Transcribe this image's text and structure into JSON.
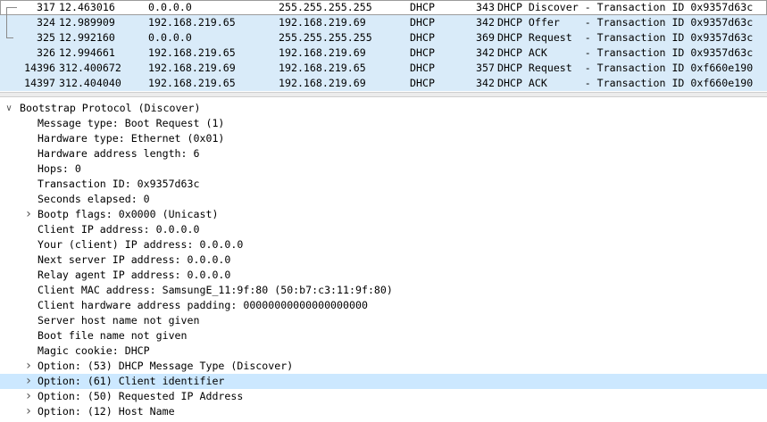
{
  "packet_list": {
    "rows": [
      {
        "no": "317",
        "time": "12.463016",
        "src": "0.0.0.0",
        "dst": "255.255.255.255",
        "proto": "DHCP",
        "len": "343",
        "info": "DHCP Discover - Transaction ID 0x9357d63c",
        "selected": true
      },
      {
        "no": "324",
        "time": "12.989909",
        "src": "192.168.219.65",
        "dst": "192.168.219.69",
        "proto": "DHCP",
        "len": "342",
        "info": "DHCP Offer    - Transaction ID 0x9357d63c",
        "selected": false
      },
      {
        "no": "325",
        "time": "12.992160",
        "src": "0.0.0.0",
        "dst": "255.255.255.255",
        "proto": "DHCP",
        "len": "369",
        "info": "DHCP Request  - Transaction ID 0x9357d63c",
        "selected": false
      },
      {
        "no": "326",
        "time": "12.994661",
        "src": "192.168.219.65",
        "dst": "192.168.219.69",
        "proto": "DHCP",
        "len": "342",
        "info": "DHCP ACK      - Transaction ID 0x9357d63c",
        "selected": false
      },
      {
        "no": "14396",
        "time": "312.400672",
        "src": "192.168.219.69",
        "dst": "192.168.219.65",
        "proto": "DHCP",
        "len": "357",
        "info": "DHCP Request  - Transaction ID 0xf660e190",
        "selected": false
      },
      {
        "no": "14397",
        "time": "312.404040",
        "src": "192.168.219.65",
        "dst": "192.168.219.69",
        "proto": "DHCP",
        "len": "342",
        "info": "DHCP ACK      - Transaction ID 0xf660e190",
        "selected": false
      }
    ]
  },
  "details": {
    "rows": [
      {
        "text": "Bootstrap Protocol (Discover)",
        "level": 0,
        "arrow": "expanded",
        "highlight": false
      },
      {
        "text": "Message type: Boot Request (1)",
        "level": 1,
        "arrow": "none",
        "highlight": false
      },
      {
        "text": "Hardware type: Ethernet (0x01)",
        "level": 1,
        "arrow": "none",
        "highlight": false
      },
      {
        "text": "Hardware address length: 6",
        "level": 1,
        "arrow": "none",
        "highlight": false
      },
      {
        "text": "Hops: 0",
        "level": 1,
        "arrow": "none",
        "highlight": false
      },
      {
        "text": "Transaction ID: 0x9357d63c",
        "level": 1,
        "arrow": "none",
        "highlight": false
      },
      {
        "text": "Seconds elapsed: 0",
        "level": 1,
        "arrow": "none",
        "highlight": false
      },
      {
        "text": "Bootp flags: 0x0000 (Unicast)",
        "level": 1,
        "arrow": "collapsed",
        "highlight": false
      },
      {
        "text": "Client IP address: 0.0.0.0",
        "level": 1,
        "arrow": "none",
        "highlight": false
      },
      {
        "text": "Your (client) IP address: 0.0.0.0",
        "level": 1,
        "arrow": "none",
        "highlight": false
      },
      {
        "text": "Next server IP address: 0.0.0.0",
        "level": 1,
        "arrow": "none",
        "highlight": false
      },
      {
        "text": "Relay agent IP address: 0.0.0.0",
        "level": 1,
        "arrow": "none",
        "highlight": false
      },
      {
        "text": "Client MAC address: SamsungE_11:9f:80 (50:b7:c3:11:9f:80)",
        "level": 1,
        "arrow": "none",
        "highlight": false
      },
      {
        "text": "Client hardware address padding: 00000000000000000000",
        "level": 1,
        "arrow": "none",
        "highlight": false
      },
      {
        "text": "Server host name not given",
        "level": 1,
        "arrow": "none",
        "highlight": false
      },
      {
        "text": "Boot file name not given",
        "level": 1,
        "arrow": "none",
        "highlight": false
      },
      {
        "text": "Magic cookie: DHCP",
        "level": 1,
        "arrow": "none",
        "highlight": false
      },
      {
        "text": "Option: (53) DHCP Message Type (Discover)",
        "level": 1,
        "arrow": "collapsed",
        "highlight": false
      },
      {
        "text": "Option: (61) Client identifier",
        "level": 1,
        "arrow": "collapsed",
        "highlight": true
      },
      {
        "text": "Option: (50) Requested IP Address",
        "level": 1,
        "arrow": "collapsed",
        "highlight": false
      },
      {
        "text": "Option: (12) Host Name",
        "level": 1,
        "arrow": "collapsed",
        "highlight": false
      }
    ]
  },
  "icons": {
    "expanded": "chevron-down-icon",
    "collapsed": "chevron-right-icon"
  },
  "colors": {
    "related_row_bg": "#d9ebf9",
    "selected_row_bg": "#ffffff",
    "highlight_row_bg": "#cce8ff"
  }
}
